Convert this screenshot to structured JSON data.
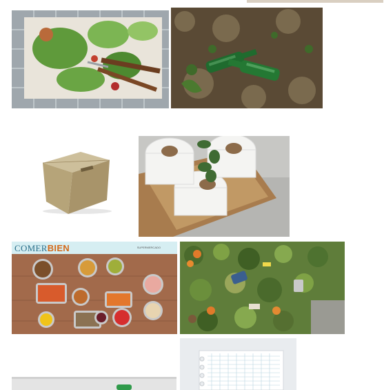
{
  "grid": {
    "images": [
      {
        "id": "salad-leftovers",
        "alt": "food-scraps-image"
      },
      {
        "id": "glass-bottles",
        "alt": "bottles-image"
      },
      {
        "id": "cardboard-box",
        "alt": "box-image"
      },
      {
        "id": "toilet-rolls",
        "alt": "toilet-paper-image"
      },
      {
        "id": "canned-food",
        "alt": "canned-food-image",
        "brand_part1": "COMER",
        "brand_part2": "BIEN",
        "small_text": "SUPERMERCADO"
      },
      {
        "id": "compost-waste",
        "alt": "compost-image"
      },
      {
        "id": "notebook-page",
        "alt": "notebook-image"
      },
      {
        "id": "partial-bottom",
        "alt": "partial-image"
      }
    ]
  },
  "colors": {
    "background": "#ffffff",
    "brand_blue": "#2b6f8a",
    "brand_orange": "#d4691a"
  }
}
